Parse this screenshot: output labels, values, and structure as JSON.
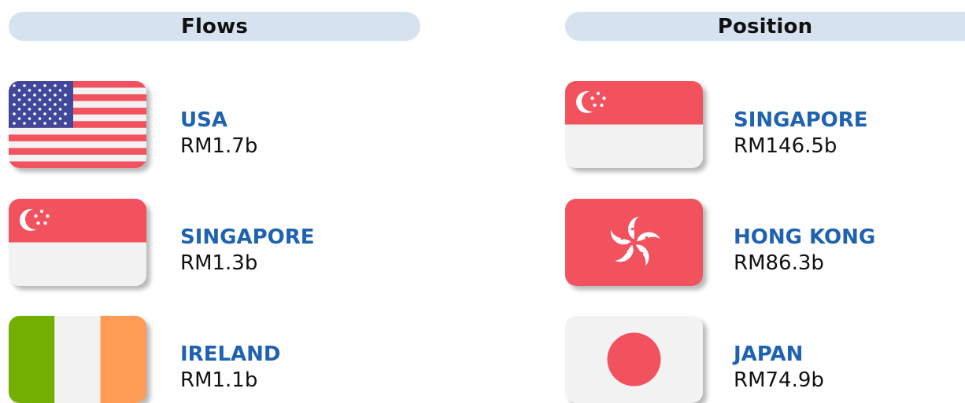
{
  "headers": {
    "flows": "Flows",
    "position": "Position"
  },
  "flows": [
    {
      "country": "USA",
      "amount": "RM1.7b",
      "flag_icon": "usa-flag-icon"
    },
    {
      "country": "SINGAPORE",
      "amount": "RM1.3b",
      "flag_icon": "singapore-flag-icon"
    },
    {
      "country": "IRELAND",
      "amount": "RM1.1b",
      "flag_icon": "ireland-flag-icon"
    }
  ],
  "position": [
    {
      "country": "SINGAPORE",
      "amount": "RM146.5b",
      "flag_icon": "singapore-flag-icon"
    },
    {
      "country": "HONG KONG",
      "amount": "RM86.3b",
      "flag_icon": "hong-kong-flag-icon"
    },
    {
      "country": "JAPAN",
      "amount": "RM74.9b",
      "flag_icon": "japan-flag-icon"
    }
  ],
  "colors": {
    "header_bg": "#d6e2ef",
    "country_name": "#1e62b0",
    "flag_red": "#f2515e",
    "flag_white": "#f2f2f2",
    "flag_blue": "#41479b",
    "flag_green": "#73af00",
    "flag_orange": "#ff9b55"
  }
}
